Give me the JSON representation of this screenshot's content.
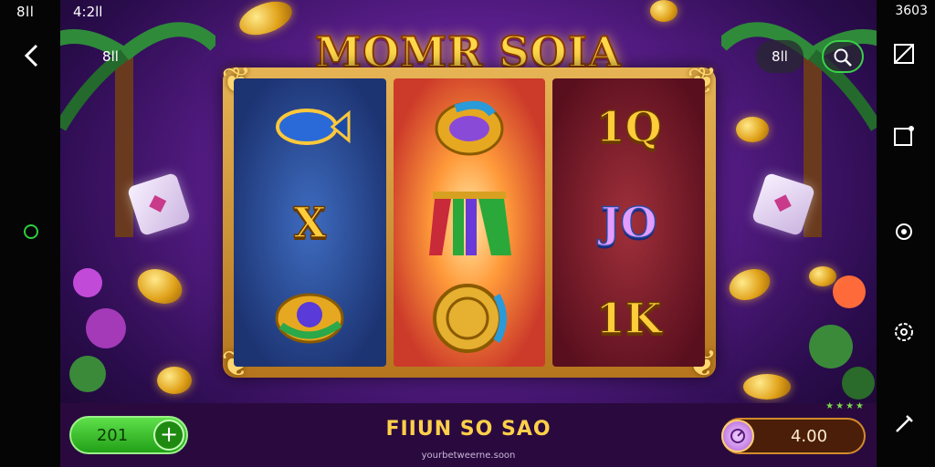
{
  "status_bar": {
    "left_label": "8ll",
    "time": "4:2ll",
    "right_label": "3603"
  },
  "top_controls": {
    "left_badge": "8ll",
    "right_badge": "8ll",
    "search_icon": "search-icon",
    "back_icon": "chevron-left-icon"
  },
  "game": {
    "title": "MOMR SOIA",
    "reels": [
      {
        "symbols": [
          {
            "icon": "fish-icon"
          },
          {
            "text": "X"
          },
          {
            "icon": "gem-swirl-icon"
          }
        ]
      },
      {
        "symbols": [
          {
            "icon": "ring-icon"
          },
          {
            "icon": "curtain-icon"
          },
          {
            "icon": "coin-stack-icon"
          }
        ]
      },
      {
        "symbols": [
          {
            "text": "1Q"
          },
          {
            "text": "JO"
          },
          {
            "text": "1K"
          }
        ]
      }
    ]
  },
  "bottom_bar": {
    "balance": "201",
    "add_button": "+",
    "spin_label": "FIIUN SO SAO",
    "website": "yourbetweerne.soon",
    "bet_value": "4.00",
    "bet_icon": "meter-icon",
    "stars": "★★★★"
  },
  "right_rail": {
    "icons": [
      "screenshot-icon",
      "window-icon",
      "settings-icon",
      "gear-icon",
      "pen-icon"
    ]
  },
  "colors": {
    "title_gold": "#ffd84a",
    "frame_gold": "#c98a2a",
    "balance_green": "#3ac82a",
    "background_purple": "#5a1e8c"
  }
}
